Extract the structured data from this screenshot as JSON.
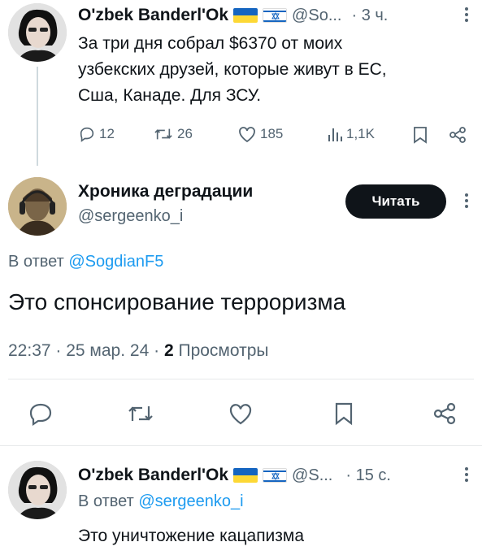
{
  "tweet1": {
    "author_name": "O'zbek Banderl'Ok",
    "handle": "@So...",
    "time": "· 3 ч.",
    "text_lines": [
      "За три дня собрал $6370 от моих",
      "узбекских друзей, которые живут в ЕС,",
      "Сша, Канаде. Для ЗСУ."
    ],
    "replies": "12",
    "retweets": "26",
    "likes": "185",
    "views": "1,1K"
  },
  "tweet2": {
    "author_name": "Хроника деградации",
    "handle": "@sergeenko_i",
    "follow_label": "Читать",
    "reply_prefix": "В ответ",
    "reply_to": "@SogdianF5",
    "text": "Это спонсирование терроризма",
    "time": "22:37",
    "date": "25 мар. 24",
    "views_count": "2",
    "views_label": "Просмотры"
  },
  "tweet3": {
    "author_name": "O'zbek Banderl'Ok",
    "handle": "@S...",
    "time": "· 15 с.",
    "reply_prefix": "В ответ",
    "reply_to": "@sergeenko_i",
    "text": "Это уничтожение кацапизма"
  },
  "colors": {
    "accent": "#1d9bf0",
    "text": "#0f1419",
    "secondary": "#536471",
    "divider": "#e7e9ea"
  }
}
